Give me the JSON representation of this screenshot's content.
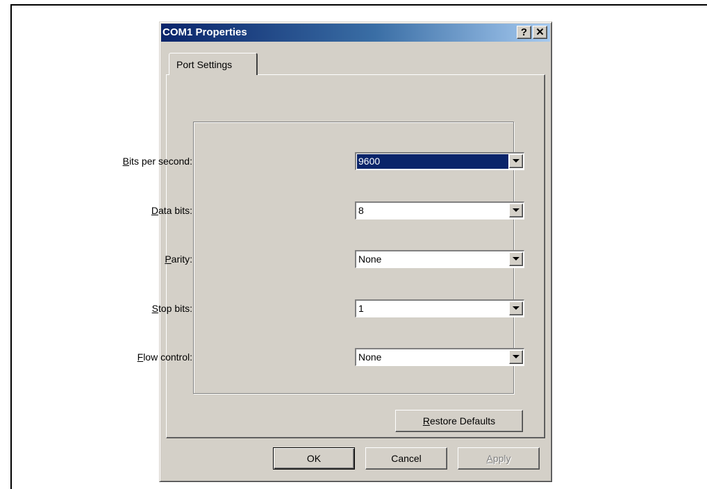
{
  "dialog": {
    "title": "COM1 Properties",
    "help_button": "?",
    "close_button": "✕"
  },
  "tabs": [
    {
      "label": "Port Settings",
      "selected": true
    }
  ],
  "fields": [
    {
      "mnemonic": "B",
      "rest": "its per second:",
      "value": "9600",
      "selected": true
    },
    {
      "mnemonic": "D",
      "rest": "ata bits:",
      "value": "8"
    },
    {
      "mnemonic": "P",
      "rest": "arity:",
      "value": "None"
    },
    {
      "mnemonic": "S",
      "rest": "top bits:",
      "value": "1"
    },
    {
      "mnemonic": "F",
      "rest": "low control:",
      "value": "None"
    }
  ],
  "restore_defaults": {
    "mnemonic": "R",
    "rest": "estore Defaults"
  },
  "buttons": {
    "ok": "OK",
    "cancel": "Cancel",
    "apply": {
      "mnemonic": "A",
      "rest": "pply",
      "disabled": true
    }
  },
  "colors": {
    "face": "#d4d0c8",
    "title_start": "#0a246a",
    "title_end": "#a6caf0",
    "selection": "#0a246a"
  }
}
